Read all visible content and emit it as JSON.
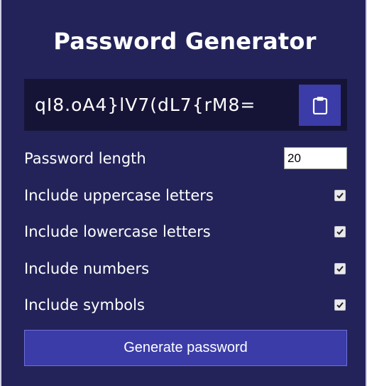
{
  "app": {
    "title": "Password Generator"
  },
  "result": {
    "password": "qI8.oA4}lV7(dL7{rM8=",
    "copy_icon": "clipboard-icon"
  },
  "settings": {
    "length_label": "Password length",
    "length_value": "20",
    "options": [
      {
        "label": "Include uppercase letters",
        "checked": true
      },
      {
        "label": "Include lowercase letters",
        "checked": true
      },
      {
        "label": "Include numbers",
        "checked": true
      },
      {
        "label": "Include symbols",
        "checked": true
      }
    ]
  },
  "actions": {
    "generate_label": "Generate password"
  },
  "colors": {
    "background": "#23235a",
    "result_bg": "#151437",
    "accent": "#3b3ca8",
    "text": "#ffffff"
  }
}
